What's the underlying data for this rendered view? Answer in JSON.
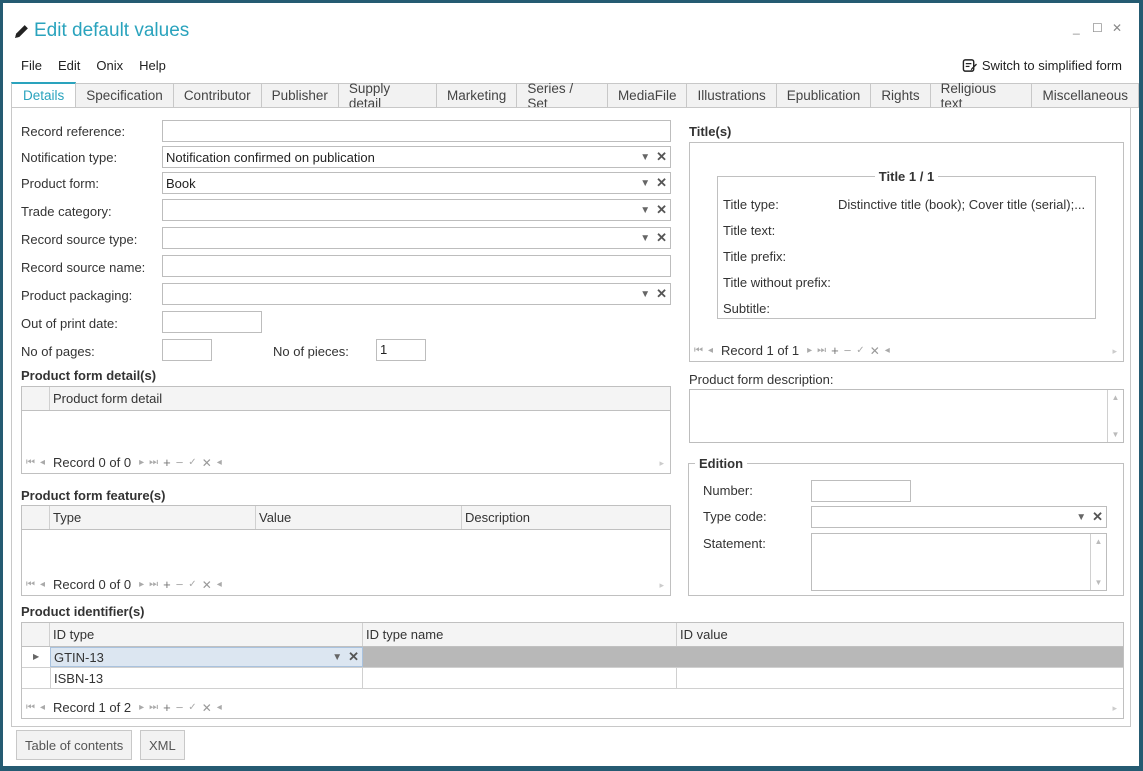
{
  "window": {
    "title": "Edit default values",
    "controls": {
      "minimize": "_",
      "maximize": "☐",
      "close": "✕"
    }
  },
  "menu": [
    "File",
    "Edit",
    "Onix",
    "Help"
  ],
  "switch_label": "Switch to simplified form",
  "tabs": [
    "Details",
    "Specification",
    "Contributor",
    "Publisher",
    "Supply detail",
    "Marketing",
    "Series / Set",
    "MediaFile",
    "Illustrations",
    "Epublication",
    "Rights",
    "Religious text",
    "Miscellaneous"
  ],
  "active_tab": "Details",
  "form": {
    "record_reference": {
      "label": "Record reference:",
      "value": ""
    },
    "notification_type": {
      "label": "Notification type:",
      "value": "Notification confirmed on publication"
    },
    "product_form": {
      "label": "Product form:",
      "value": "Book"
    },
    "trade_category": {
      "label": "Trade category:",
      "value": ""
    },
    "record_source_type": {
      "label": "Record source type:",
      "value": ""
    },
    "record_source_name": {
      "label": "Record source name:",
      "value": ""
    },
    "product_packaging": {
      "label": "Product packaging:",
      "value": ""
    },
    "out_of_print_date": {
      "label": "Out of print date:",
      "value": ""
    },
    "no_of_pages": {
      "label": "No of pages:",
      "value": ""
    },
    "no_of_pieces": {
      "label": "No of pieces:",
      "value": "1"
    }
  },
  "product_form_details": {
    "title": "Product form detail(s)",
    "columns": [
      "Product form detail"
    ],
    "record_text": "Record 0 of 0"
  },
  "product_form_features": {
    "title": "Product form feature(s)",
    "columns": [
      "Type",
      "Value",
      "Description"
    ],
    "record_text": "Record 0 of 0"
  },
  "product_identifiers": {
    "title": "Product identifier(s)",
    "columns": [
      "ID type",
      "ID type name",
      "ID value"
    ],
    "rows": [
      {
        "id_type": "GTIN-13",
        "id_type_name": "",
        "id_value": "",
        "selected": true
      },
      {
        "id_type": "ISBN-13",
        "id_type_name": "",
        "id_value": "",
        "selected": false
      }
    ],
    "record_text": "Record 1 of 2"
  },
  "titles": {
    "title": "Title(s)",
    "group_title": "Title 1 / 1",
    "fields": [
      {
        "label": "Title type:",
        "value": "Distinctive title (book); Cover title (serial);..."
      },
      {
        "label": "Title text:",
        "value": ""
      },
      {
        "label": "Title prefix:",
        "value": ""
      },
      {
        "label": "Title without prefix:",
        "value": ""
      },
      {
        "label": "Subtitle:",
        "value": ""
      }
    ],
    "record_text": "Record 1 of 1"
  },
  "product_form_description": {
    "label": "Product form description:",
    "value": ""
  },
  "edition": {
    "title": "Edition",
    "number": {
      "label": "Number:",
      "value": ""
    },
    "type_code": {
      "label": "Type code:",
      "value": ""
    },
    "statement": {
      "label": "Statement:",
      "value": ""
    }
  },
  "bottom_buttons": [
    "Table of contents",
    "XML"
  ],
  "nav_icons": {
    "first": "⏮",
    "prev": "◂",
    "next": "▸",
    "last": "⏭",
    "add": "+",
    "delete": "−",
    "apply": "✓",
    "cancel": "✕"
  },
  "colors": {
    "accent": "#2aa3bd",
    "frame": "#255b72",
    "selected_cell": "#dce6f1",
    "selected_row": "#b8b8b8"
  }
}
